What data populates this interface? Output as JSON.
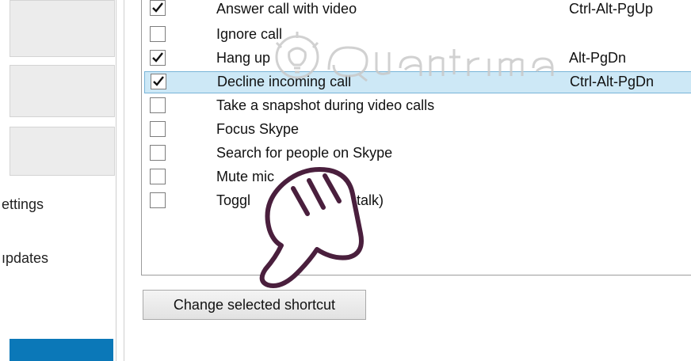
{
  "sidebar": {
    "links": [
      "ettings",
      "ıpdates"
    ]
  },
  "shortcuts": {
    "rows": [
      {
        "label": "Answer call with video",
        "keys": "Ctrl-Alt-PgUp",
        "checked": true
      },
      {
        "label": "Ignore call",
        "keys": "",
        "checked": false
      },
      {
        "label": "Hang up",
        "keys": "Alt-PgDn",
        "checked": true
      },
      {
        "label": "Decline incoming call",
        "keys": "Ctrl-Alt-PgDn",
        "checked": true,
        "selected": true
      },
      {
        "label": "Take a snapshot during video calls",
        "keys": "",
        "checked": false
      },
      {
        "label": "Focus Skype",
        "keys": "",
        "checked": false
      },
      {
        "label": "Search for people on Skype",
        "keys": "",
        "checked": false
      },
      {
        "label": "Mute mic",
        "keys": "",
        "checked": false
      },
      {
        "label": "Toggl",
        "label_tail": "to-talk)",
        "keys": "",
        "checked": false
      }
    ]
  },
  "buttons": {
    "change_shortcut": "Change selected shortcut"
  },
  "colors": {
    "selection_bg": "#cde8f6",
    "sidebar_active": "#0b78b8"
  },
  "icons": [
    "checkmark-icon",
    "pointing-hand-icon",
    "watermark-logo"
  ]
}
